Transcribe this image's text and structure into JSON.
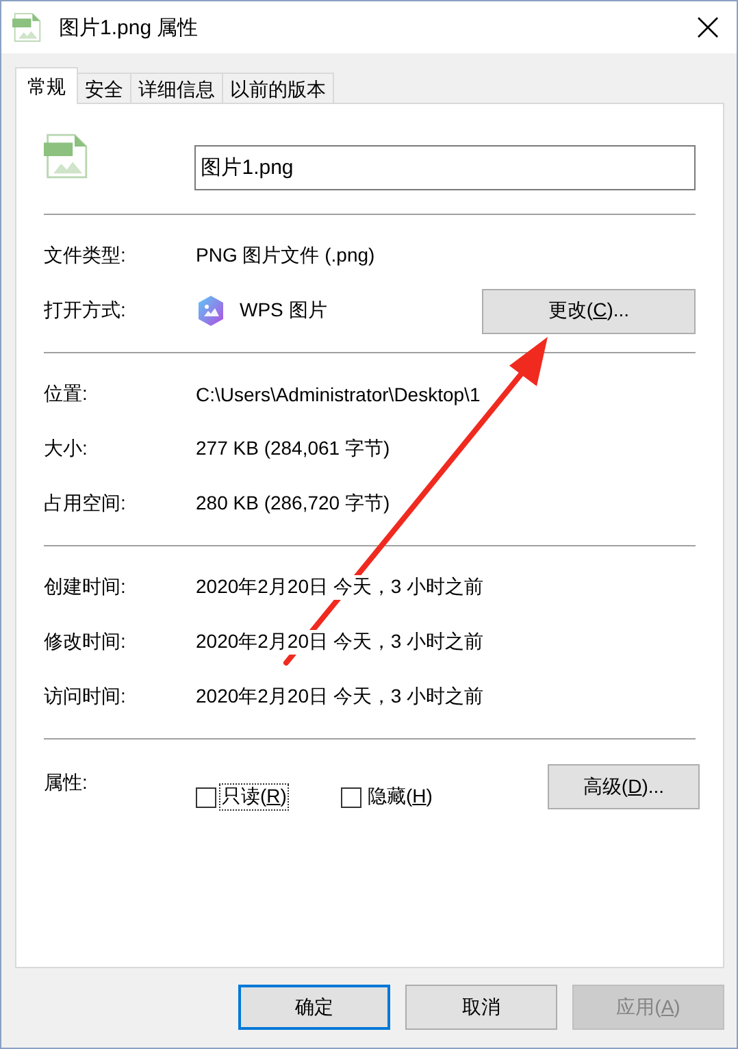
{
  "window": {
    "title": "图片1.png 属性"
  },
  "tabs": [
    {
      "label": "常规",
      "selected": true
    },
    {
      "label": "安全",
      "selected": false
    },
    {
      "label": "详细信息",
      "selected": false
    },
    {
      "label": "以前的版本",
      "selected": false
    }
  ],
  "file_name": {
    "value": "图片1.png"
  },
  "groups": [
    {
      "rows": [
        {
          "kind": "text",
          "label": "文件类型:",
          "value": "PNG 图片文件 (.png)"
        },
        {
          "kind": "app",
          "label": "打开方式:",
          "value": "WPS 图片",
          "button": {
            "pre": "更改(",
            "key": "C",
            "post": ")..."
          }
        }
      ]
    },
    {
      "rows": [
        {
          "kind": "text",
          "label": "位置:",
          "value": "C:\\Users\\Administrator\\Desktop\\1"
        },
        {
          "kind": "text",
          "label": "大小:",
          "value": "277 KB (284,061 字节)"
        },
        {
          "kind": "text",
          "label": "占用空间:",
          "value": "280 KB (286,720 字节)"
        }
      ]
    },
    {
      "rows": [
        {
          "kind": "text",
          "label": "创建时间:",
          "value": "2020年2月20日 今天，3 小时之前"
        },
        {
          "kind": "text",
          "label": "修改时间:",
          "value": "2020年2月20日 今天，3 小时之前"
        },
        {
          "kind": "text",
          "label": "访问时间:",
          "value": "2020年2月20日 今天，3 小时之前"
        }
      ]
    },
    {
      "rows": [
        {
          "kind": "attributes",
          "label": "属性:",
          "checkboxes": [
            {
              "pre": "只读(",
              "key": "R",
              "post": ")",
              "checked": false,
              "focused": true
            },
            {
              "pre": "隐藏(",
              "key": "H",
              "post": ")",
              "checked": false,
              "focused": false
            }
          ],
          "button": {
            "pre": "高级(",
            "key": "D",
            "post": ")..."
          }
        }
      ]
    }
  ],
  "footer_buttons": [
    {
      "pre": "确定",
      "default": true,
      "disabled": false
    },
    {
      "pre": "取消",
      "default": false,
      "disabled": false
    },
    {
      "pre": "应用(",
      "key": "A",
      "post": ")",
      "default": false,
      "disabled": true
    }
  ],
  "overlay": {
    "kind": "arrow"
  }
}
